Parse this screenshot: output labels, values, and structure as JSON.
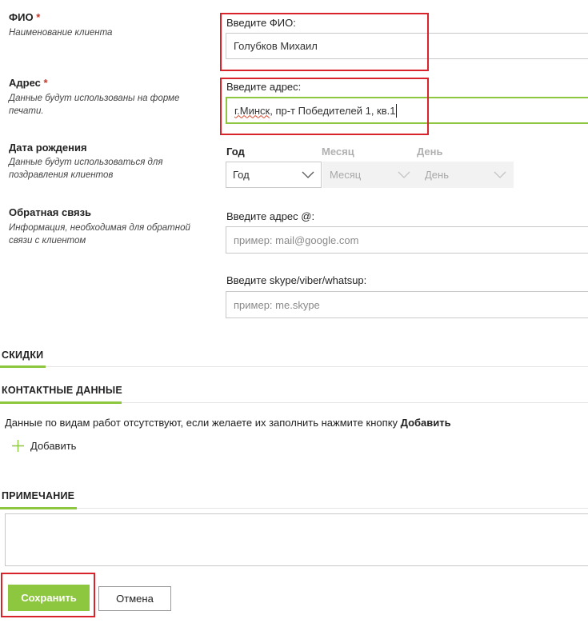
{
  "fio": {
    "title": "ФИО",
    "required_mark": "*",
    "hint": "Наименование клиента",
    "caption": "Введите ФИО:",
    "value": "Голубков Михаил"
  },
  "address": {
    "title": "Адрес",
    "required_mark": "*",
    "hint_line1": "Данные будут использованы на форме",
    "hint_line2": "печати.",
    "caption": "Введите адрес:",
    "value_city": "г.Минск",
    "value_rest": ", пр-т Победителей 1, кв.1"
  },
  "birthday": {
    "title": "Дата рождения",
    "hint_line1": "Данные будут использоваться для",
    "hint_line2": "поздравления клиентов",
    "year_caption": "Год",
    "month_caption": "Месяц",
    "day_caption": "День",
    "year_value": "Год",
    "month_value": "Месяц",
    "day_value": "День"
  },
  "feedback": {
    "title": "Обратная связь",
    "hint_line1": "Информация, необходимая для обратной",
    "hint_line2": "связи с клиентом",
    "email_caption": "Введите адрес @:",
    "email_placeholder": "пример: mail@google.com",
    "skype_caption": "Введите skype/viber/whatsup:",
    "skype_placeholder": "пример: me.skype"
  },
  "sections": {
    "discounts": "СКИДКИ",
    "contacts": "КОНТАКТНЫЕ ДАННЫЕ",
    "contacts_empty_text": "Данные по видам работ отсутствуют, если желаете их заполнить нажмите кнопку",
    "contacts_empty_button_ref": "Добавить",
    "add_label": "Добавить",
    "note": "ПРИМЕЧАНИЕ"
  },
  "actions": {
    "save_label": "Сохранить",
    "cancel_label": "Отмена"
  },
  "colors": {
    "accent": "#8dc63f",
    "highlight": "#d9232b",
    "required": "#c0392b"
  }
}
